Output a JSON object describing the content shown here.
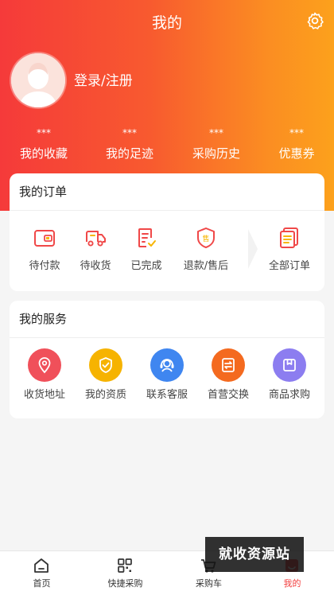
{
  "header": {
    "title": "我的"
  },
  "profile": {
    "login_label": "登录/注册"
  },
  "stats": [
    {
      "value": "***",
      "label": "我的收藏"
    },
    {
      "value": "***",
      "label": "我的足迹"
    },
    {
      "value": "***",
      "label": "采购历史"
    },
    {
      "value": "***",
      "label": "优惠券"
    }
  ],
  "orders": {
    "title": "我的订单",
    "items": [
      {
        "label": "待付款",
        "icon": "wallet-icon"
      },
      {
        "label": "待收货",
        "icon": "truck-icon"
      },
      {
        "label": "已完成",
        "icon": "checklist-icon"
      },
      {
        "label": "退款/售后",
        "icon": "shield-after-sale-icon"
      },
      {
        "label": "全部订单",
        "icon": "orders-list-icon"
      }
    ]
  },
  "services": {
    "title": "我的服务",
    "items": [
      {
        "label": "收货地址",
        "icon": "location-pin-icon",
        "color": "#f0505a"
      },
      {
        "label": "我的资质",
        "icon": "shield-check-icon",
        "color": "#f6b300"
      },
      {
        "label": "联系客服",
        "icon": "headset-icon",
        "color": "#3f86f0"
      },
      {
        "label": "首营交换",
        "icon": "exchange-doc-icon",
        "color": "#f46a1f"
      },
      {
        "label": "商品求购",
        "icon": "box-icon",
        "color": "#8c7df0"
      }
    ]
  },
  "tabbar": [
    {
      "label": "首页",
      "icon": "home-icon"
    },
    {
      "label": "快捷采购",
      "icon": "scan-grid-icon"
    },
    {
      "label": "采购车",
      "icon": "cart-icon"
    },
    {
      "label": "我的",
      "icon": "profile-icon",
      "active": true
    }
  ],
  "watermark": "就收资源站",
  "colors": {
    "gradient_start": "#f53a3a",
    "gradient_end": "#fca11c",
    "accent": "#f23d3d"
  }
}
